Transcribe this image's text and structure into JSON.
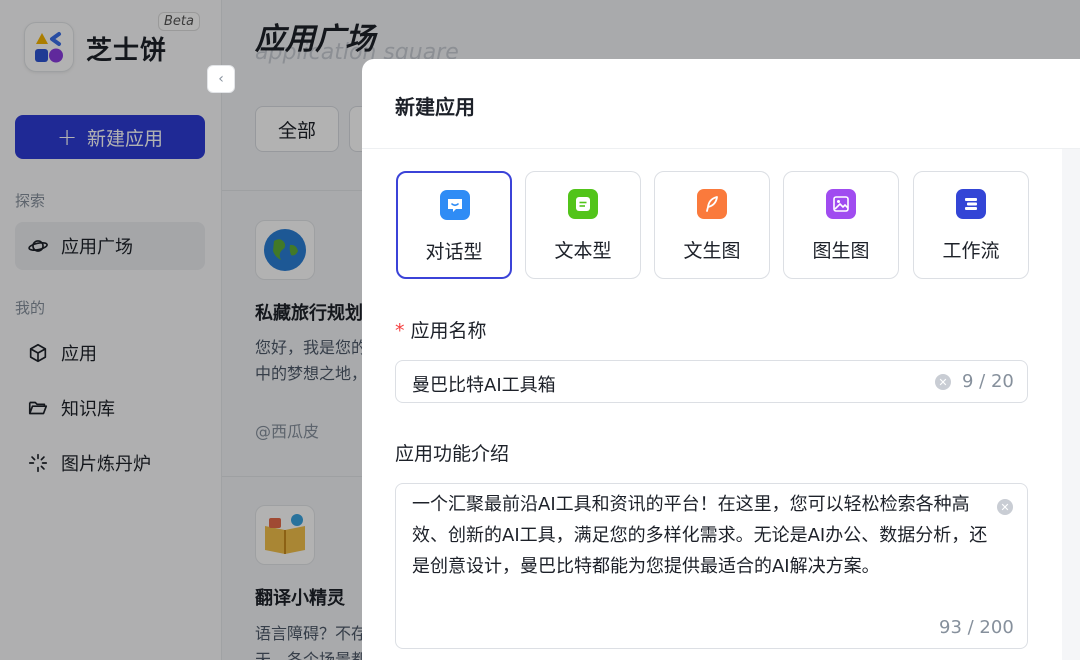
{
  "sidebar": {
    "brand": "芝士饼",
    "badge": "Beta",
    "new_app_label": "新建应用",
    "sections": [
      {
        "label": "探索",
        "items": [
          {
            "label": "应用广场",
            "icon": "planet-icon",
            "active": true
          }
        ]
      },
      {
        "label": "我的",
        "items": [
          {
            "label": "应用",
            "icon": "cube-icon"
          },
          {
            "label": "知识库",
            "icon": "folder-open-icon"
          },
          {
            "label": "图片炼丹炉",
            "icon": "sparkle-icon"
          }
        ]
      }
    ]
  },
  "main": {
    "title": "应用广场",
    "subtitle": "application square",
    "filter_all": "全部",
    "cards": [
      {
        "title": "私藏旅行规划",
        "desc_line1": "您好，我是您的",
        "desc_line2": "中的梦想之地，",
        "author": "@西瓜皮",
        "icon": "globe-icon"
      },
      {
        "title": "翻译小精灵",
        "desc_line1": "语言障碍？不存",
        "desc_line2": "天，各个场景都",
        "icon": "book-icon"
      }
    ]
  },
  "modal": {
    "title": "新建应用",
    "types": [
      {
        "label": "对话型",
        "icon": "chat-icon",
        "color": "#2f8cf5",
        "selected": true
      },
      {
        "label": "文本型",
        "icon": "text-icon",
        "color": "#52c41a"
      },
      {
        "label": "文生图",
        "icon": "feather-icon",
        "color": "#fa7a3c"
      },
      {
        "label": "图生图",
        "icon": "image-icon",
        "color": "#a04cf0"
      },
      {
        "label": "工作流",
        "icon": "workflow-icon",
        "color": "#3345d6"
      }
    ],
    "name_field": {
      "label": "应用名称",
      "required_mark": "*",
      "value": "曼巴比特AI工具箱",
      "count": "9 / 20"
    },
    "desc_field": {
      "label": "应用功能介绍",
      "value": "一个汇聚最前沿AI工具和资讯的平台！在这里，您可以轻松检索各种高效、创新的AI工具，满足您的多样化需求。无论是AI办公、数据分析，还是创意设计，曼巴比特都能为您提供最适合的AI解决方案。",
      "count": "93 / 200"
    }
  }
}
